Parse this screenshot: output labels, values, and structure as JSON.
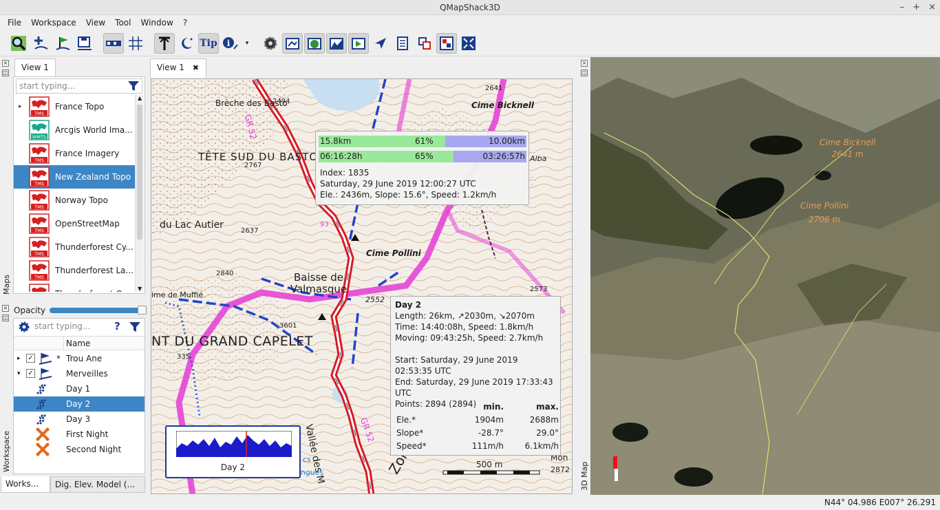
{
  "window": {
    "title": "QMapShack3D",
    "buttons": [
      "–",
      "+",
      "×"
    ]
  },
  "menu": [
    "File",
    "Workspace",
    "View",
    "Tool",
    "Window",
    "?"
  ],
  "toolbar": {
    "icons": [
      "search-map-icon",
      "add-waypoint-icon",
      "route-icon",
      "save-gis-icon",
      "scale-icon",
      "grid-icon",
      "text-tool-icon",
      "night-icon",
      "tip-icon",
      "info-icon",
      "settings-gear-icon",
      "map-setup-icon",
      "dem-setup-icon",
      "profile-icon",
      "map-view-icon",
      "select-icon",
      "list-icon",
      "swap-icon",
      "puzzle-icon",
      "fullscreen-icon"
    ],
    "tip_label": "Tip"
  },
  "maps_dock": {
    "label": "Maps",
    "tab": "View 1",
    "search_placeholder": "start typing...",
    "items": [
      {
        "name": "France Topo",
        "type": "TMS",
        "expandable": true,
        "selected": false
      },
      {
        "name": "Arcgis World Ima...",
        "type": "WMTS",
        "expandable": false,
        "selected": false
      },
      {
        "name": "France Imagery",
        "type": "TMS",
        "expandable": false,
        "selected": false
      },
      {
        "name": "New Zealand Topo",
        "type": "TMS",
        "expandable": false,
        "selected": true
      },
      {
        "name": "Norway Topo",
        "type": "TMS",
        "expandable": false,
        "selected": false
      },
      {
        "name": "OpenStreetMap",
        "type": "TMS",
        "expandable": false,
        "selected": false
      },
      {
        "name": "Thunderforest Cy...",
        "type": "TMS",
        "expandable": false,
        "selected": false
      },
      {
        "name": "Thunderforest La...",
        "type": "TMS",
        "expandable": false,
        "selected": false
      },
      {
        "name": "Thunderforest O...",
        "type": "TMS",
        "expandable": false,
        "selected": false
      }
    ],
    "opacity_label": "Opacity",
    "opacity_value": 1.0
  },
  "workspace_dock": {
    "label": "Workspace",
    "search_placeholder": "start typing...",
    "column_name": "Name",
    "rows": [
      {
        "label": "Trou Ane",
        "kind": "project",
        "checked": true,
        "star": "*",
        "arrow": "▸",
        "selected": false
      },
      {
        "label": "Merveilles",
        "kind": "project",
        "checked": true,
        "star": "",
        "arrow": "▾",
        "selected": false
      },
      {
        "label": "Day 1",
        "kind": "track",
        "selected": false
      },
      {
        "label": "Day 2",
        "kind": "track",
        "selected": true
      },
      {
        "label": "Day 3",
        "kind": "track",
        "selected": false
      },
      {
        "label": "First Night",
        "kind": "waypoint",
        "selected": false
      },
      {
        "label": "Second Night",
        "kind": "waypoint",
        "selected": false
      }
    ],
    "bottom_tabs": [
      "Works...",
      "Dig. Elev. Model (..."
    ]
  },
  "view_tab": {
    "label": "View 1",
    "close": "✖"
  },
  "map": {
    "labels": [
      "Brèche des Basto",
      "2494",
      "2641",
      "Cime Bicknell",
      "TÊTE SUD DU BASTO",
      "2767",
      "du Lac Autier",
      "2637",
      "Cime Pollini",
      "Baisse de Valmasque",
      "2840",
      "ime de Muffié",
      "2552",
      "2573",
      "3601",
      "NT DU GRAND CAPELET",
      "335",
      "Vallée des M",
      "Zone",
      "GR 52",
      "GR 52",
      "Mon",
      "2872",
      "Alba",
      "93",
      "cs",
      "angues"
    ],
    "scale_label": "500 m"
  },
  "tooltip_track": {
    "rows": [
      {
        "left": "15.8km",
        "pct": "61%",
        "right": "10.00km",
        "fraction": 0.61
      },
      {
        "left": "06:16:28h",
        "pct": "65%",
        "right": "03:26:57h",
        "fraction": 0.65
      }
    ],
    "index": "Index: 1835",
    "date": "Saturday, 29 June 2019 12:00:27 UTC",
    "ele": "Ele.: 2436m, Slope: 15.6°, Speed: 1.2km/h"
  },
  "tooltip_day": {
    "title": "Day 2",
    "length": "Length: 26km, ↗2030m, ↘2070m",
    "time": "Time: 14:40:08h, Speed: 1.8km/h",
    "moving": "Moving: 09:43:25h, Speed: 2.7km/h",
    "start": "Start: Saturday, 29 June 2019 02:53:35 UTC",
    "end": "End: Saturday, 29 June 2019 17:33:43 UTC",
    "points": "Points: 2894 (2894)",
    "col_min": "min.",
    "col_max": "max.",
    "stats": [
      {
        "name": "Ele.*",
        "min": "1904m",
        "max": "2688m"
      },
      {
        "name": "Slope*",
        "min": "-28.7°",
        "max": "29.0°"
      },
      {
        "name": "Speed*",
        "min": "111m/h",
        "max": "6.1km/h"
      }
    ]
  },
  "profile_widget": {
    "label": "Day 2"
  },
  "view3d": {
    "dock_label": "3D Map",
    "labels": [
      {
        "name": "Cime Bicknell",
        "elev": "2641 m"
      },
      {
        "name": "Cime Pollini",
        "elev": "2706 m"
      }
    ]
  },
  "statusbar": {
    "coords": "N44° 04.986 E007° 26.291"
  }
}
